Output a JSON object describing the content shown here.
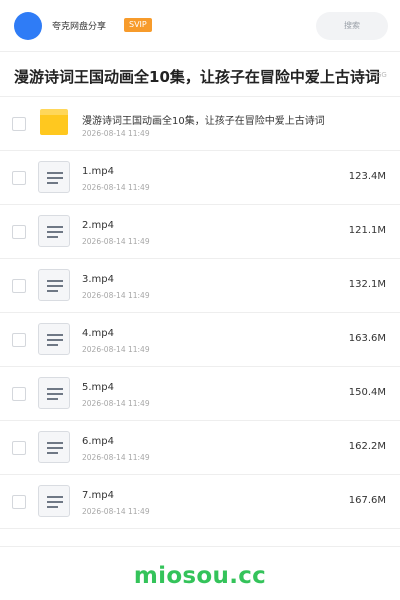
{
  "header": {
    "share_name": "夸克网盘分享",
    "badge": "SVIP",
    "search_placeholder": "搜索"
  },
  "title": {
    "text": "漫游诗词王国动画全10集，让孩子在冒险中爱上古诗词",
    "overflow_tail": "GG"
  },
  "items": [
    {
      "type": "folder",
      "name": "漫游诗词王国动画全10集，让孩子在冒险中爱上古诗词",
      "date": "2026-08-14 11:49",
      "size": ""
    },
    {
      "type": "file",
      "name": "1.mp4",
      "date": "2026-08-14 11:49",
      "size": "123.4M"
    },
    {
      "type": "file",
      "name": "2.mp4",
      "date": "2026-08-14 11:49",
      "size": "121.1M"
    },
    {
      "type": "file",
      "name": "3.mp4",
      "date": "2026-08-14 11:49",
      "size": "132.1M"
    },
    {
      "type": "file",
      "name": "4.mp4",
      "date": "2026-08-14 11:49",
      "size": "163.6M"
    },
    {
      "type": "file",
      "name": "5.mp4",
      "date": "2026-08-14 11:49",
      "size": "150.4M"
    },
    {
      "type": "file",
      "name": "6.mp4",
      "date": "2026-08-14 11:49",
      "size": "162.2M"
    },
    {
      "type": "file",
      "name": "7.mp4",
      "date": "2026-08-14 11:49",
      "size": "167.6M"
    }
  ],
  "footer": {
    "brand": "miosou.cc"
  },
  "colors": {
    "avatar": "#2f7cf6",
    "badge": "#f79b2b",
    "folder": "#ffc81f",
    "footer_brand": "#34c35a"
  }
}
